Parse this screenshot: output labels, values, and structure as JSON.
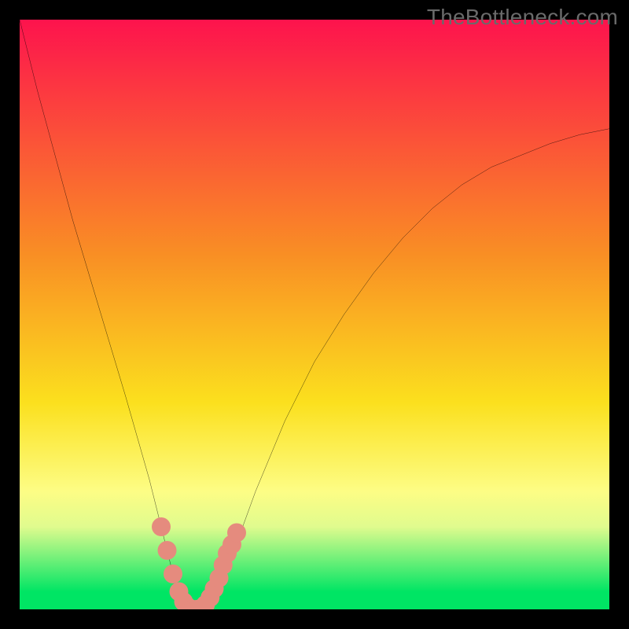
{
  "watermark": "TheBottleneck.com",
  "chart_data": {
    "type": "line",
    "title": "",
    "xlabel": "",
    "ylabel": "",
    "xlim": [
      0,
      100
    ],
    "ylim": [
      0,
      100
    ],
    "background_gradient": [
      {
        "y": 100,
        "color": "#fd134d"
      },
      {
        "y": 60,
        "color": "#f98f24"
      },
      {
        "y": 35,
        "color": "#fbe01e"
      },
      {
        "y": 20,
        "color": "#fdfd85"
      },
      {
        "y": 14,
        "color": "#e0fb8e"
      },
      {
        "y": 3,
        "color": "#00e564"
      },
      {
        "y": 0,
        "color": "#00e564"
      }
    ],
    "series": [
      {
        "name": "bottleneck-curve",
        "color": "#000000",
        "x": [
          0,
          3,
          6,
          9,
          12,
          15,
          18,
          20,
          22,
          24,
          25,
          26,
          27,
          28,
          29,
          30,
          31,
          32,
          34,
          36,
          40,
          45,
          50,
          55,
          60,
          65,
          70,
          75,
          80,
          85,
          90,
          95,
          100
        ],
        "y": [
          100,
          88,
          77,
          66,
          56,
          46,
          36,
          29,
          22,
          14,
          10,
          6,
          3,
          1,
          0,
          0,
          0,
          1,
          4,
          9,
          20,
          32,
          42,
          50,
          57,
          63,
          68,
          72,
          75,
          77,
          79,
          80.5,
          81.5
        ]
      }
    ],
    "dots": {
      "name": "highlight-dots",
      "color": "#e58b7e",
      "radius": 1.6,
      "points": [
        {
          "x": 24.0,
          "y": 14.0
        },
        {
          "x": 25.0,
          "y": 10.0
        },
        {
          "x": 26.0,
          "y": 6.0
        },
        {
          "x": 27.0,
          "y": 3.0
        },
        {
          "x": 27.8,
          "y": 1.3
        },
        {
          "x": 28.5,
          "y": 0.4
        },
        {
          "x": 29.3,
          "y": 0.0
        },
        {
          "x": 30.0,
          "y": 0.0
        },
        {
          "x": 30.8,
          "y": 0.2
        },
        {
          "x": 31.5,
          "y": 0.8
        },
        {
          "x": 32.3,
          "y": 2.0
        },
        {
          "x": 33.0,
          "y": 3.5
        },
        {
          "x": 33.8,
          "y": 5.3
        },
        {
          "x": 34.5,
          "y": 7.5
        },
        {
          "x": 35.2,
          "y": 9.5
        },
        {
          "x": 36.0,
          "y": 11.0
        },
        {
          "x": 36.8,
          "y": 13.0
        }
      ]
    }
  }
}
